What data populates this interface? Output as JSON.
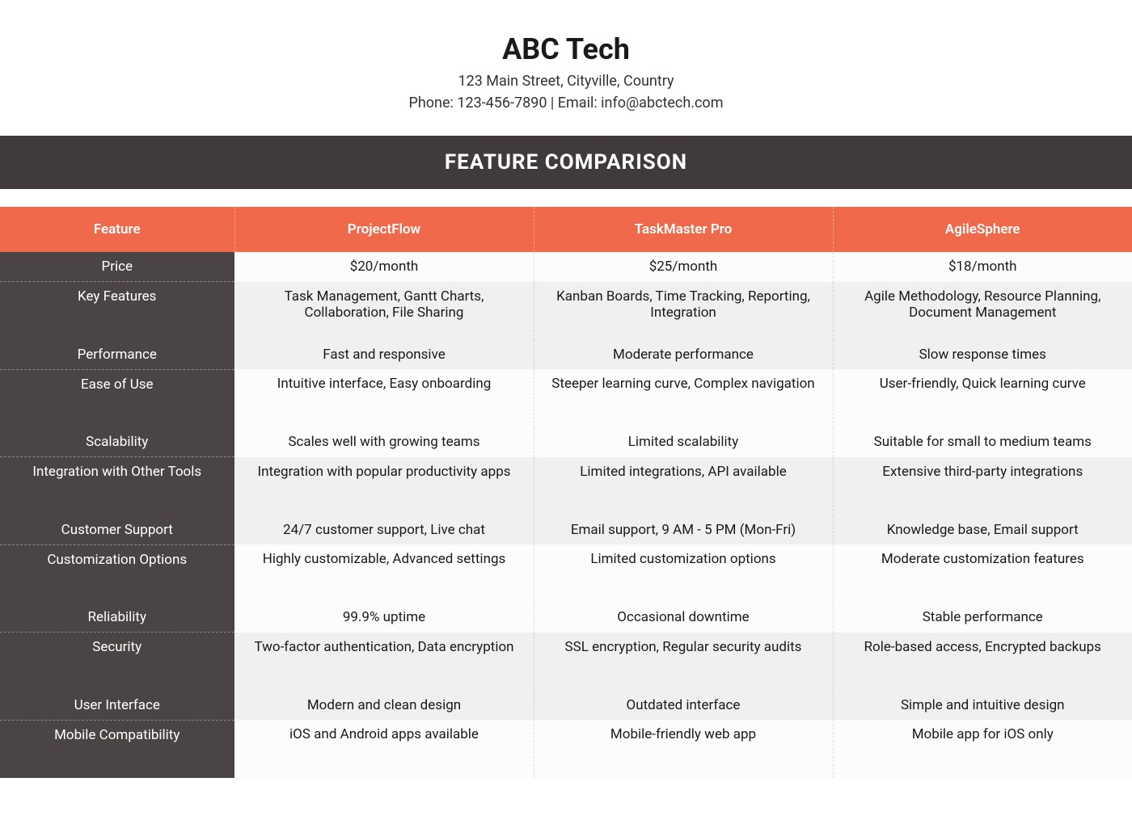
{
  "header": {
    "company_name": "ABC Tech",
    "address": "123 Main Street, Cityville, Country",
    "contact": "Phone: 123-456-7890 | Email: info@abctech.com"
  },
  "banner": "FEATURE COMPARISON",
  "table": {
    "columns": [
      "Feature",
      "ProjectFlow",
      "TaskMaster Pro",
      "AgileSphere"
    ],
    "rows": [
      {
        "feature": "Price",
        "cells": [
          "$20/month",
          "$25/month",
          "$18/month"
        ]
      },
      {
        "feature": "Key Features",
        "cells": [
          "Task Management, Gantt Charts, Collaboration, File Sharing",
          "Kanban Boards, Time Tracking, Reporting, Integration",
          "Agile Methodology, Resource Planning, Document Management"
        ]
      },
      {
        "feature": "Performance",
        "cells": [
          "Fast and responsive",
          "Moderate performance",
          "Slow response times"
        ]
      },
      {
        "feature": "Ease of Use",
        "cells": [
          "Intuitive interface, Easy onboarding",
          "Steeper learning curve, Complex navigation",
          "User-friendly, Quick learning curve"
        ]
      },
      {
        "feature": "Scalability",
        "cells": [
          "Scales well with growing teams",
          "Limited scalability",
          "Suitable for small to medium teams"
        ]
      },
      {
        "feature": "Integration with Other Tools",
        "cells": [
          "Integration with popular productivity apps",
          "Limited integrations, API available",
          "Extensive third-party integrations"
        ]
      },
      {
        "feature": "Customer Support",
        "cells": [
          "24/7 customer support, Live chat",
          "Email support, 9 AM - 5 PM (Mon-Fri)",
          "Knowledge base, Email support"
        ]
      },
      {
        "feature": "Customization Options",
        "cells": [
          "Highly customizable, Advanced settings",
          "Limited customization options",
          "Moderate customization features"
        ]
      },
      {
        "feature": "Reliability",
        "cells": [
          "99.9% uptime",
          "Occasional downtime",
          "Stable performance"
        ]
      },
      {
        "feature": "Security",
        "cells": [
          "Two-factor authentication, Data encryption",
          "SSL encryption, Regular security audits",
          "Role-based access, Encrypted backups"
        ]
      },
      {
        "feature": "User Interface",
        "cells": [
          "Modern and clean design",
          "Outdated interface",
          "Simple and intuitive design"
        ]
      },
      {
        "feature": "Mobile Compatibility",
        "cells": [
          "iOS and Android apps available",
          "Mobile-friendly web app",
          "Mobile app for iOS only"
        ]
      }
    ]
  }
}
